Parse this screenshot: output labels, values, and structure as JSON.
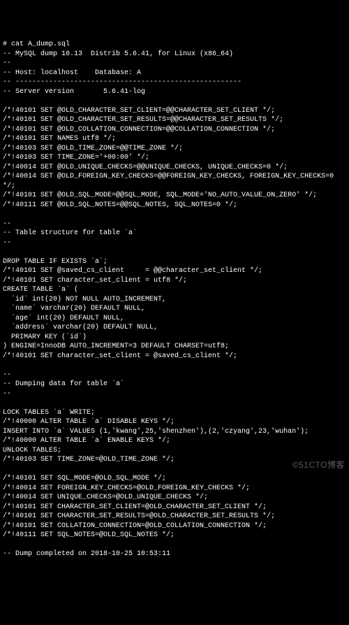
{
  "lines": [
    "# cat A_dump.sql",
    "-- MySQL dump 10.13  Distrib 5.6.41, for Linux (x86_64)",
    "--",
    "-- Host: localhost    Database: A",
    "-- ------------------------------------------------------",
    "-- Server version       5.6.41-log",
    "",
    "/*!40101 SET @OLD_CHARACTER_SET_CLIENT=@@CHARACTER_SET_CLIENT */;",
    "/*!40101 SET @OLD_CHARACTER_SET_RESULTS=@@CHARACTER_SET_RESULTS */;",
    "/*!40101 SET @OLD_COLLATION_CONNECTION=@@COLLATION_CONNECTION */;",
    "/*!40101 SET NAMES utf8 */;",
    "/*!40103 SET @OLD_TIME_ZONE=@@TIME_ZONE */;",
    "/*!40103 SET TIME_ZONE='+00:00' */;",
    "/*!40014 SET @OLD_UNIQUE_CHECKS=@@UNIQUE_CHECKS, UNIQUE_CHECKS=0 */;",
    "/*!40014 SET @OLD_FOREIGN_KEY_CHECKS=@@FOREIGN_KEY_CHECKS, FOREIGN_KEY_CHECKS=0 */;",
    "/*!40101 SET @OLD_SQL_MODE=@@SQL_MODE, SQL_MODE='NO_AUTO_VALUE_ON_ZERO' */;",
    "/*!40111 SET @OLD_SQL_NOTES=@@SQL_NOTES, SQL_NOTES=0 */;",
    "",
    "--",
    "-- Table structure for table `a`",
    "--",
    "",
    "DROP TABLE IF EXISTS `a`;",
    "/*!40101 SET @saved_cs_client     = @@character_set_client */;",
    "/*!40101 SET character_set_client = utf8 */;",
    "CREATE TABLE `a` (",
    "  `id` int(20) NOT NULL AUTO_INCREMENT,",
    "  `name` varchar(20) DEFAULT NULL,",
    "  `age` int(20) DEFAULT NULL,",
    "  `address` varchar(20) DEFAULT NULL,",
    "  PRIMARY KEY (`id`)",
    ") ENGINE=InnoDB AUTO_INCREMENT=3 DEFAULT CHARSET=utf8;",
    "/*!40101 SET character_set_client = @saved_cs_client */;",
    "",
    "--",
    "-- Dumping data for table `a`",
    "--",
    "",
    "LOCK TABLES `a` WRITE;",
    "/*!40000 ALTER TABLE `a` DISABLE KEYS */;",
    "INSERT INTO `a` VALUES (1,'kwang',25,'shenzhen'),(2,'czyang',23,'wuhan');",
    "/*!40000 ALTER TABLE `a` ENABLE KEYS */;",
    "UNLOCK TABLES;",
    "/*!40103 SET TIME_ZONE=@OLD_TIME_ZONE */;",
    "",
    "/*!40101 SET SQL_MODE=@OLD_SQL_MODE */;",
    "/*!40014 SET FOREIGN_KEY_CHECKS=@OLD_FOREIGN_KEY_CHECKS */;",
    "/*!40014 SET UNIQUE_CHECKS=@OLD_UNIQUE_CHECKS */;",
    "/*!40101 SET CHARACTER_SET_CLIENT=@OLD_CHARACTER_SET_CLIENT */;",
    "/*!40101 SET CHARACTER_SET_RESULTS=@OLD_CHARACTER_SET_RESULTS */;",
    "/*!40101 SET COLLATION_CONNECTION=@OLD_COLLATION_CONNECTION */;",
    "/*!40111 SET SQL_NOTES=@OLD_SQL_NOTES */;",
    "",
    "-- Dump completed on 2018-10-25 10:53:11"
  ],
  "watermark": "©51CTO博客"
}
